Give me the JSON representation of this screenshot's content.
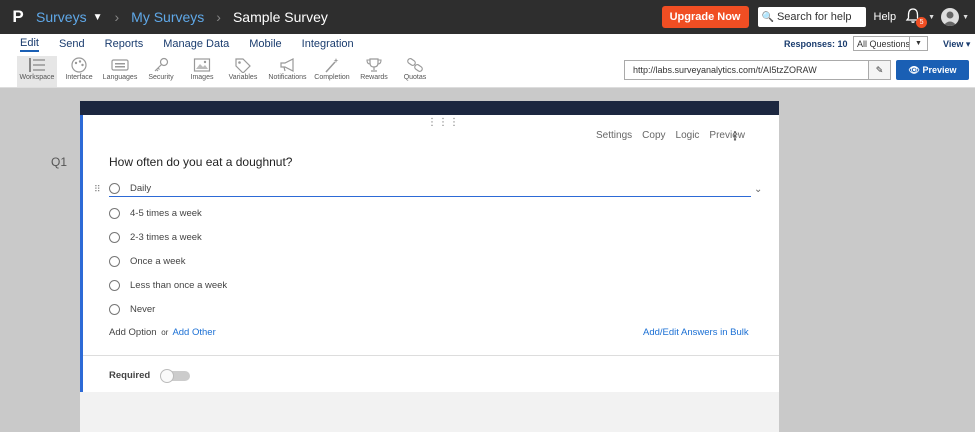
{
  "topbar": {
    "logo": "P",
    "surveys": "Surveys",
    "my_surveys": "My Surveys",
    "survey_name": "Sample Survey",
    "upgrade": "Upgrade Now",
    "search_placeholder": "Search for help",
    "help": "Help",
    "notifications": "5"
  },
  "menu": {
    "items": [
      "Edit",
      "Send",
      "Reports",
      "Manage Data",
      "Mobile",
      "Integration"
    ],
    "responses": "Responses: 10",
    "filter": "All Questions",
    "view": "View"
  },
  "toolbar": {
    "tools": [
      "Workspace",
      "Interface",
      "Languages",
      "Security",
      "Images",
      "Variables",
      "Notifications",
      "Completion",
      "Rewards",
      "Quotas"
    ],
    "url": "http://labs.surveyanalytics.com/t/AI5tzZORAW",
    "preview": "Preview"
  },
  "question": {
    "number": "Q1",
    "actions": [
      "Settings",
      "Copy",
      "Logic",
      "Preview"
    ],
    "title": "How often do you eat a doughnut?",
    "options": [
      "Daily",
      "4-5 times a week",
      "2-3 times a week",
      "Once a week",
      "Less than once a week",
      "Never"
    ],
    "add_option": "Add Option",
    "or": "or",
    "add_other": "Add Other",
    "bulk": "Add/Edit Answers in Bulk",
    "required": "Required"
  }
}
